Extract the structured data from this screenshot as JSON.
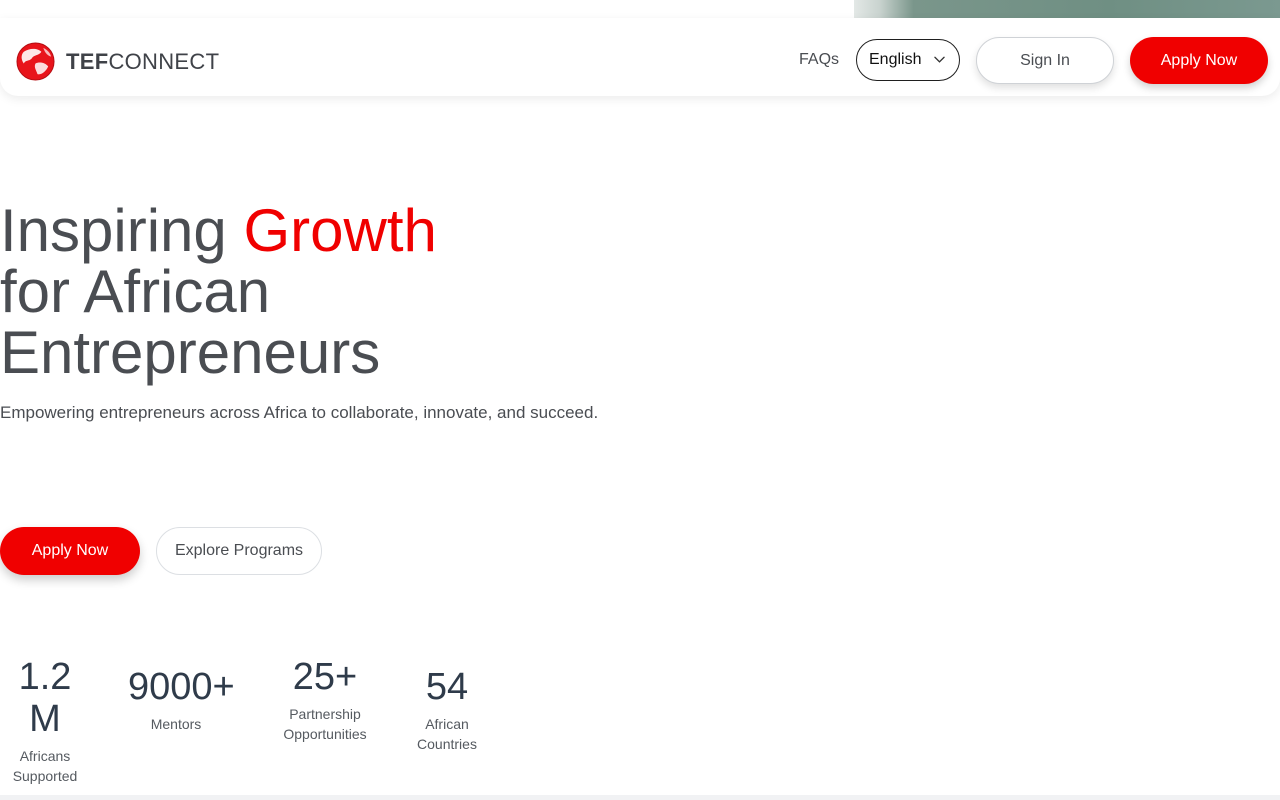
{
  "brand": {
    "name_bold": "TEF",
    "name_rest": "CONNECT",
    "logo_icon": "globe-icon"
  },
  "nav": {
    "faq": "FAQs",
    "language": "English",
    "sign_in": "Sign In",
    "apply": "Apply Now"
  },
  "hero": {
    "title_part1": "Inspiring ",
    "title_highlight": "Growth",
    "title_line2": "for African",
    "title_line3": "Entrepreneurs",
    "subtitle": "Empowering entrepreneurs across Africa to collaborate, innovate, and succeed.",
    "apply_label": "Apply Now",
    "explore_label": "Explore Programs"
  },
  "stats": [
    {
      "value": "1.2 M",
      "label_line1": "Africans",
      "label_line2": "Supported"
    },
    {
      "value": "9000+",
      "label_line1": "Mentors",
      "label_line2": ""
    },
    {
      "value": "25+",
      "label_line1": "Partnership",
      "label_line2": "Opportunities"
    },
    {
      "value": "54",
      "label_line1": "African",
      "label_line2": "Countries"
    }
  ],
  "colors": {
    "accent": "#f00000",
    "text": "#4a4d52",
    "stat": "#2f3b4a"
  }
}
